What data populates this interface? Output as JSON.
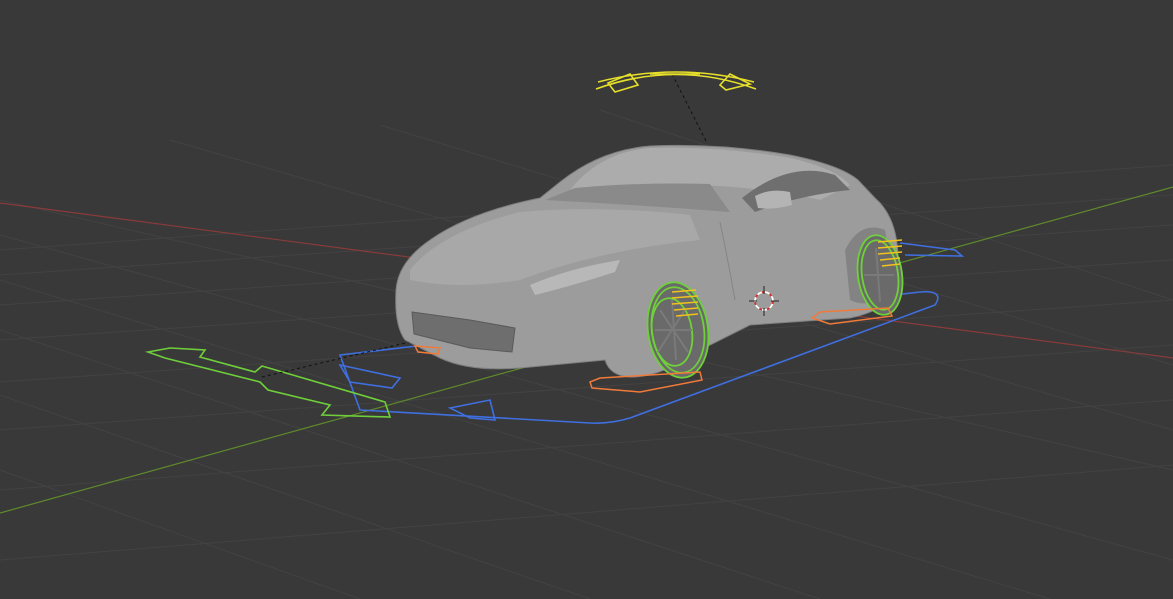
{
  "app": {
    "name": "3D Viewport"
  },
  "viewport": {
    "background": "#393939",
    "grid_color": "#454545",
    "axis_x_color": "#8a3a3a",
    "axis_y_color": "#5f8a2c"
  },
  "scene": {
    "object": {
      "name": "car-body",
      "color": "#9c9c9c"
    },
    "controls": {
      "steering_color": "#e7e02b",
      "wheel_color": "#6fd13a",
      "suspension_color": "#f2c21c",
      "root_color": "#3f6fe0",
      "move_arrow_color": "#6fcf3b",
      "wheel_base_color": "#f07a3a"
    },
    "cursor": {
      "name": "3d-cursor",
      "icon": "crosshair-icon",
      "color": "#d23030"
    }
  }
}
